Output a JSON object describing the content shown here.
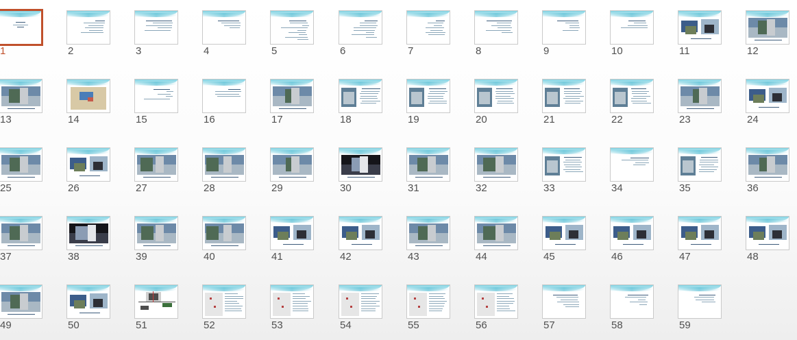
{
  "slide_sorter": {
    "selected_slide": "1",
    "accent_color": "#c0502b",
    "slides": [
      {
        "number": "1",
        "thumbnail": "title"
      },
      {
        "number": "2",
        "thumbnail": "text"
      },
      {
        "number": "3",
        "thumbnail": "text"
      },
      {
        "number": "4",
        "thumbnail": "text"
      },
      {
        "number": "5",
        "thumbnail": "text"
      },
      {
        "number": "6",
        "thumbnail": "text"
      },
      {
        "number": "7",
        "thumbnail": "text"
      },
      {
        "number": "8",
        "thumbnail": "text"
      },
      {
        "number": "9",
        "thumbnail": "text"
      },
      {
        "number": "10",
        "thumbnail": "text"
      },
      {
        "number": "11",
        "thumbnail": "images"
      },
      {
        "number": "12",
        "thumbnail": "photo"
      },
      {
        "number": "13",
        "thumbnail": "photo"
      },
      {
        "number": "14",
        "thumbnail": "map"
      },
      {
        "number": "15",
        "thumbnail": "text"
      },
      {
        "number": "16",
        "thumbnail": "text"
      },
      {
        "number": "17",
        "thumbnail": "photo"
      },
      {
        "number": "18",
        "thumbnail": "photo-text"
      },
      {
        "number": "19",
        "thumbnail": "photo-text"
      },
      {
        "number": "20",
        "thumbnail": "photo-text"
      },
      {
        "number": "21",
        "thumbnail": "photo-text"
      },
      {
        "number": "22",
        "thumbnail": "photo-text"
      },
      {
        "number": "23",
        "thumbnail": "photo"
      },
      {
        "number": "24",
        "thumbnail": "images"
      },
      {
        "number": "25",
        "thumbnail": "photo"
      },
      {
        "number": "26",
        "thumbnail": "images"
      },
      {
        "number": "27",
        "thumbnail": "photo"
      },
      {
        "number": "28",
        "thumbnail": "photo"
      },
      {
        "number": "29",
        "thumbnail": "photo"
      },
      {
        "number": "30",
        "thumbnail": "photo-dark"
      },
      {
        "number": "31",
        "thumbnail": "photo"
      },
      {
        "number": "32",
        "thumbnail": "photo"
      },
      {
        "number": "33",
        "thumbnail": "photo-text"
      },
      {
        "number": "34",
        "thumbnail": "text"
      },
      {
        "number": "35",
        "thumbnail": "photo-text"
      },
      {
        "number": "36",
        "thumbnail": "photo"
      },
      {
        "number": "37",
        "thumbnail": "photo"
      },
      {
        "number": "38",
        "thumbnail": "photo-dark"
      },
      {
        "number": "39",
        "thumbnail": "photo"
      },
      {
        "number": "40",
        "thumbnail": "photo"
      },
      {
        "number": "41",
        "thumbnail": "images"
      },
      {
        "number": "42",
        "thumbnail": "images"
      },
      {
        "number": "43",
        "thumbnail": "photo"
      },
      {
        "number": "44",
        "thumbnail": "photo"
      },
      {
        "number": "45",
        "thumbnail": "images"
      },
      {
        "number": "46",
        "thumbnail": "images"
      },
      {
        "number": "47",
        "thumbnail": "images"
      },
      {
        "number": "48",
        "thumbnail": "images"
      },
      {
        "number": "49",
        "thumbnail": "photo"
      },
      {
        "number": "50",
        "thumbnail": "images"
      },
      {
        "number": "51",
        "thumbnail": "diagram"
      },
      {
        "number": "52",
        "thumbnail": "plan-text"
      },
      {
        "number": "53",
        "thumbnail": "plan-text"
      },
      {
        "number": "54",
        "thumbnail": "plan-text"
      },
      {
        "number": "55",
        "thumbnail": "plan-text"
      },
      {
        "number": "56",
        "thumbnail": "plan-text"
      },
      {
        "number": "57",
        "thumbnail": "text"
      },
      {
        "number": "58",
        "thumbnail": "text"
      },
      {
        "number": "59",
        "thumbnail": "text"
      }
    ]
  }
}
